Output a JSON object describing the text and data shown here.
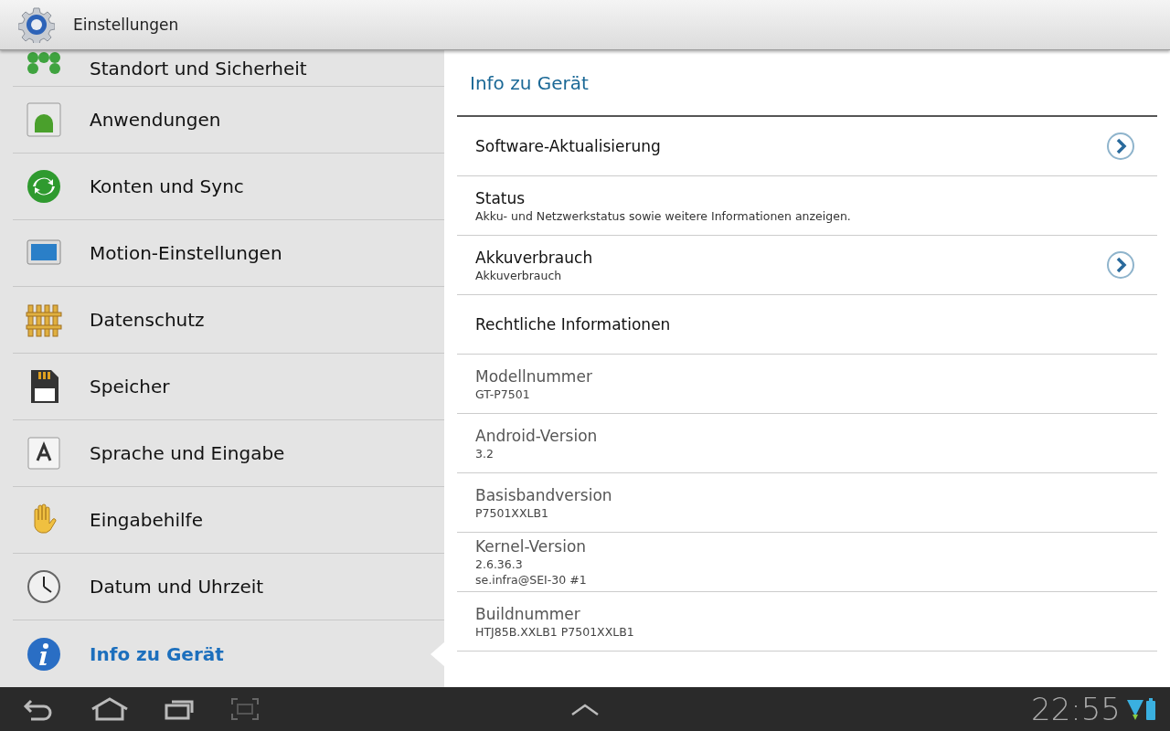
{
  "header": {
    "title": "Einstellungen"
  },
  "sidebar": {
    "items": [
      {
        "label": "Standort und Sicherheit",
        "selected": false
      },
      {
        "label": "Anwendungen",
        "selected": false
      },
      {
        "label": "Konten und Sync",
        "selected": false
      },
      {
        "label": "Motion-Einstellungen",
        "selected": false
      },
      {
        "label": "Datenschutz",
        "selected": false
      },
      {
        "label": "Speicher",
        "selected": false
      },
      {
        "label": "Sprache und Eingabe",
        "selected": false
      },
      {
        "label": "Eingabehilfe",
        "selected": false
      },
      {
        "label": "Datum und Uhrzeit",
        "selected": false
      },
      {
        "label": "Info zu Gerät",
        "selected": true
      }
    ]
  },
  "detail": {
    "title": "Info zu Gerät",
    "items": [
      {
        "title": "Software-Aktualisierung",
        "arrow": true,
        "disabled": false
      },
      {
        "title": "Status",
        "lines": [
          "Akku- und Netzwerkstatus sowie weitere Informationen anzeigen."
        ],
        "arrow": false,
        "disabled": false
      },
      {
        "title": "Akkuverbrauch",
        "lines": [
          "Akkuverbrauch"
        ],
        "arrow": true,
        "disabled": false
      },
      {
        "title": "Rechtliche Informationen",
        "arrow": false,
        "disabled": false
      },
      {
        "title": "Modellnummer",
        "lines": [
          "GT-P7501"
        ],
        "arrow": false,
        "disabled": true
      },
      {
        "title": "Android-Version",
        "lines": [
          "3.2"
        ],
        "arrow": false,
        "disabled": true
      },
      {
        "title": "Basisbandversion",
        "lines": [
          "P7501XXLB1"
        ],
        "arrow": false,
        "disabled": true
      },
      {
        "title": "Kernel-Version",
        "lines": [
          "2.6.36.3",
          "se.infra@SEI-30 #1"
        ],
        "arrow": false,
        "disabled": true
      },
      {
        "title": "Buildnummer",
        "lines": [
          "HTJ85B.XXLB1 P7501XXLB1"
        ],
        "arrow": false,
        "disabled": true
      }
    ]
  },
  "navbar": {
    "time": "22:55"
  }
}
